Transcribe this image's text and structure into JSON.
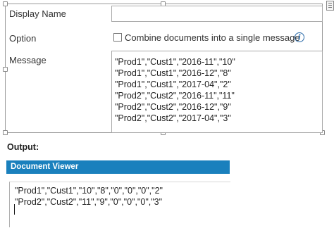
{
  "form": {
    "display_name_label": "Display Name",
    "display_name_value": "",
    "option_label": "Option",
    "combine_checkbox_checked": false,
    "combine_checkbox_label": "Combine documents into a single message",
    "message_label": "Message",
    "message_lines": [
      "\"Prod1\",\"Cust1\",\"2016-11\",\"10\"",
      "\"Prod1\",\"Cust1\",\"2016-12\",\"8\"",
      "\"Prod1\",\"Cust1\",\"2017-04\",\"2\"",
      "\"Prod2\",\"Cust2\",\"2016-11\",\"11\"",
      "\"Prod2\",\"Cust2\",\"2016-12\",\"9\"",
      "\"Prod2\",\"Cust2\",\"2017-04\",\"3\""
    ]
  },
  "output": {
    "heading": "Output:",
    "viewer_title": "Document Viewer",
    "lines": [
      "\"Prod1\",\"Cust1\",\"10\",\"8\",\"0\",\"0\",\"0\",\"2\"",
      "\"Prod2\",\"Cust2\",\"11\",\"9\",\"0\",\"0\",\"0\",\"3\""
    ]
  },
  "icons": {
    "info": "info-icon",
    "panel_toggle": "panel-toggle-icon"
  },
  "colors": {
    "viewer_bar": "#1a80bd",
    "info_icon": "#2a6aa8"
  }
}
